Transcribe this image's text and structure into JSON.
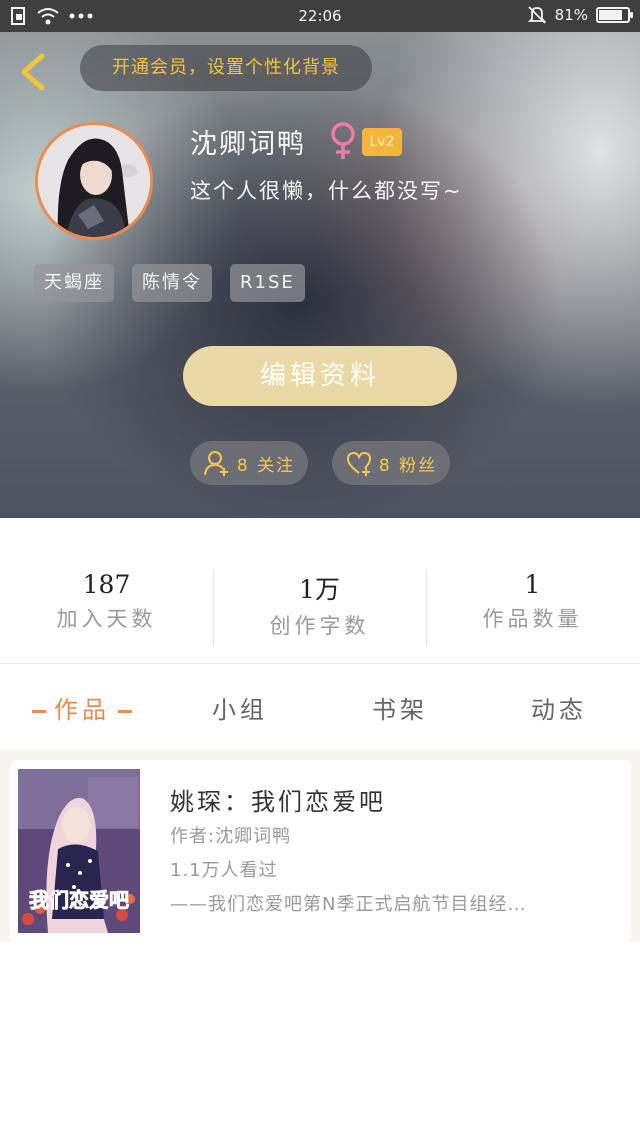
{
  "status_bar": {
    "time": "22:06",
    "battery": "81%",
    "battery_level": 0.81,
    "icons": [
      "sim-icon",
      "wifi-icon",
      "more-dots-icon",
      "mute-bell-icon",
      "battery-icon"
    ]
  },
  "header": {
    "vip_banner": "开通会员，设置个性化背景",
    "username": "沈卿词鸭",
    "gender": "female",
    "level": "Lv2",
    "bio": "这个人很懒，什么都没写~",
    "tags": [
      "天蝎座",
      "陈情令",
      "R1SE"
    ],
    "edit_button": "编辑资料",
    "following": "8 关注",
    "fans": "8 粉丝"
  },
  "stats": [
    {
      "value": "187",
      "label": "加入天数"
    },
    {
      "value": "1万",
      "label": "创作字数"
    },
    {
      "value": "1",
      "label": "作品数量"
    }
  ],
  "tabs": [
    {
      "label": "作品",
      "active": true
    },
    {
      "label": "小组",
      "active": false
    },
    {
      "label": "书架",
      "active": false
    },
    {
      "label": "动态",
      "active": false
    }
  ],
  "works": [
    {
      "title": "姚琛：我们恋爱吧",
      "author": "作者:沈卿词鸭",
      "views": "1.1万人看过",
      "description": "——我们恋爱吧第N季正式启航节目组经…",
      "cover_text": "我们恋爱吧"
    }
  ],
  "colors": {
    "accent": "#f08a4b",
    "gold": "#f3c53a",
    "edit_button": "#ead8a6",
    "level_badge": "#f5b53a"
  }
}
